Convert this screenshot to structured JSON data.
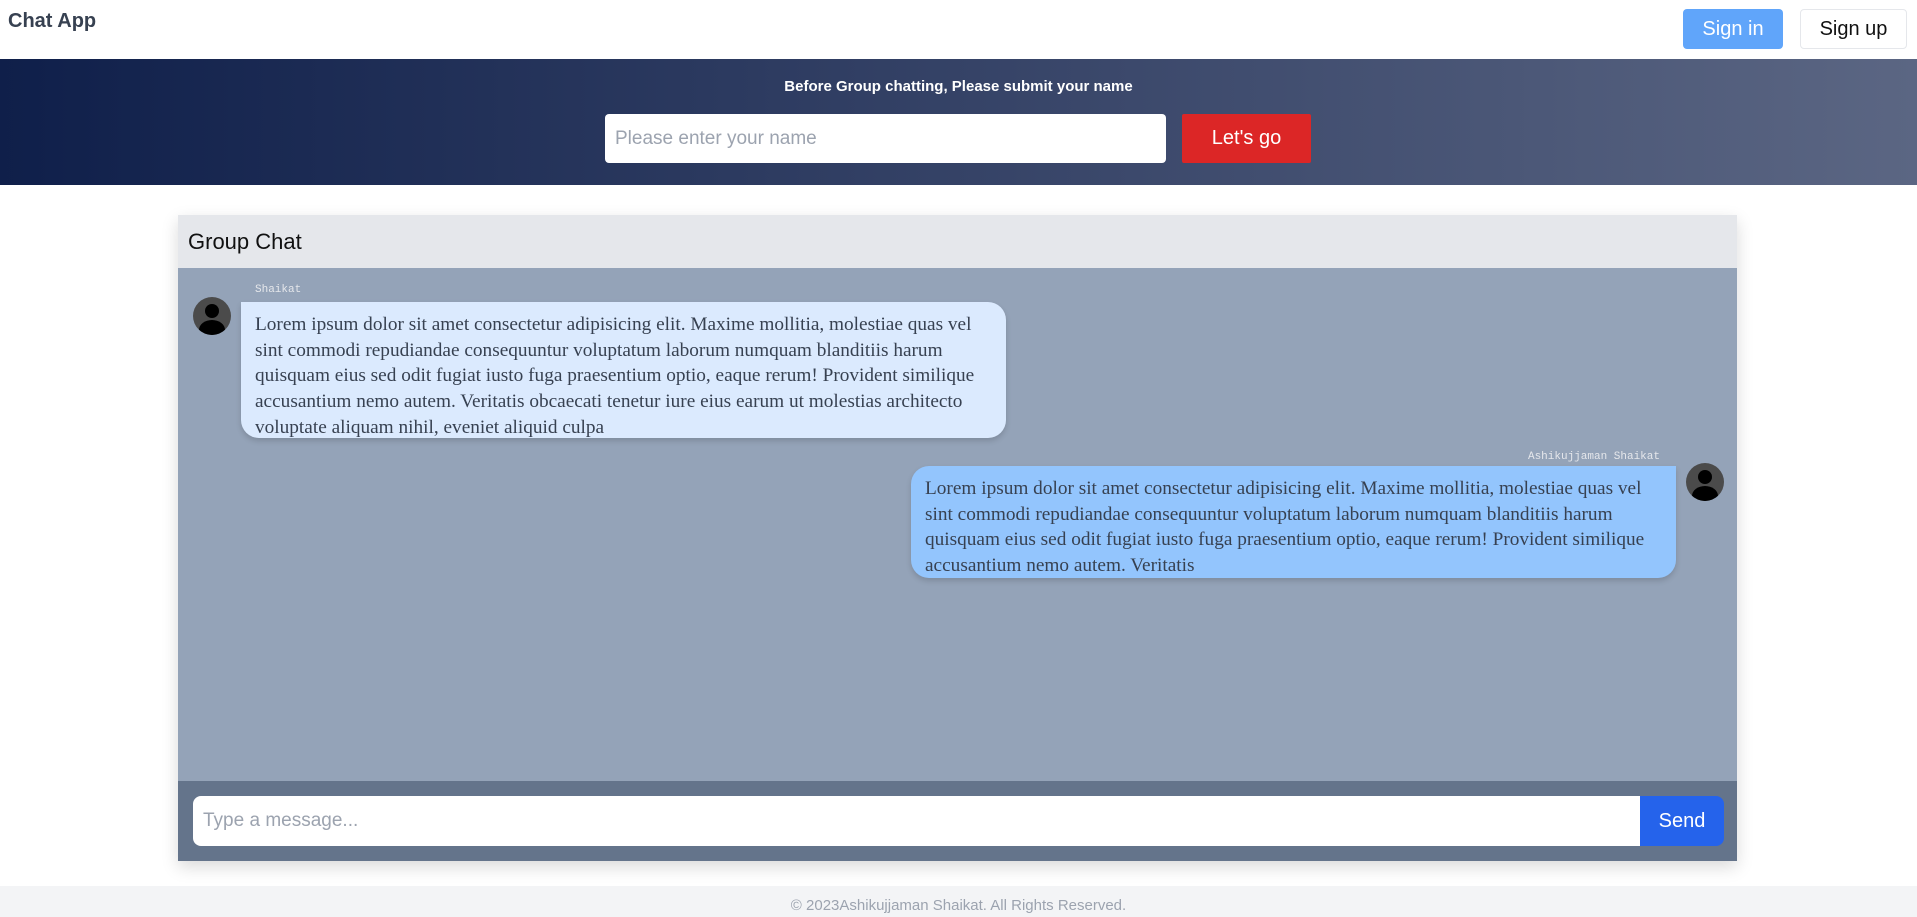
{
  "navbar": {
    "brand": "Chat App",
    "signin_label": "Sign in",
    "signup_label": "Sign up"
  },
  "banner": {
    "text": "Before Group chatting, Please submit your name",
    "name_placeholder": "Please enter your name",
    "submit_label": "Let's go"
  },
  "chat": {
    "title": "Group Chat",
    "messages": [
      {
        "sender": "Shaikat",
        "text": "Lorem ipsum dolor sit amet consectetur adipisicing elit. Maxime mollitia, molestiae quas vel sint commodi repudiandae consequuntur voluptatum laborum numquam blanditiis harum quisquam eius sed odit fugiat iusto fuga praesentium optio, eaque rerum! Provident similique accusantium nemo autem. Veritatis obcaecati tenetur iure eius earum ut molestias architecto voluptate aliquam nihil, eveniet aliquid culpa"
      },
      {
        "sender": "Ashikujjaman Shaikat",
        "text": "Lorem ipsum dolor sit amet consectetur adipisicing elit. Maxime mollitia, molestiae quas vel sint commodi repudiandae consequuntur voluptatum laborum numquam blanditiis harum quisquam eius sed odit fugiat iusto fuga praesentium optio, eaque rerum! Provident similique accusantium nemo autem. Veritatis"
      }
    ],
    "message_placeholder": "Type a message...",
    "send_label": "Send"
  },
  "footer": {
    "text": "© 2023Ashikujjaman Shaikat. All Rights Reserved."
  }
}
